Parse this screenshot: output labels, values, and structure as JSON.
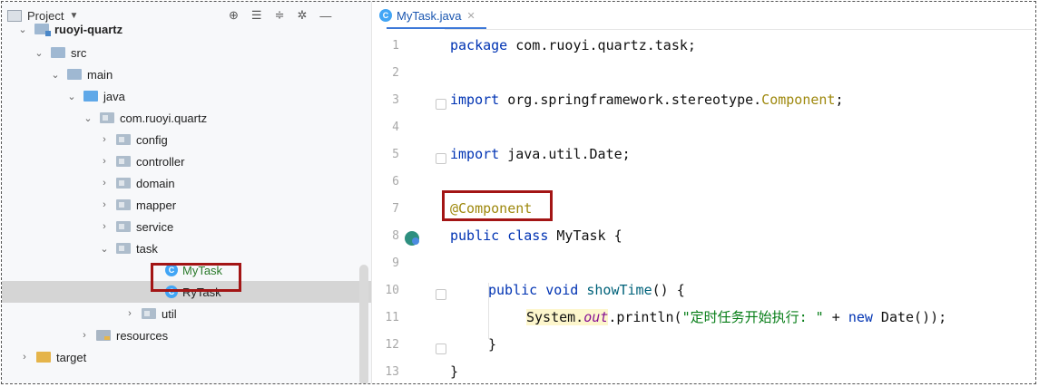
{
  "project_panel": {
    "title": "Project",
    "tree": [
      {
        "label": "ruoyi-quartz"
      },
      {
        "label": "src"
      },
      {
        "label": "main"
      },
      {
        "label": "java"
      },
      {
        "label": "com.ruoyi.quartz"
      },
      {
        "label": "config"
      },
      {
        "label": "controller"
      },
      {
        "label": "domain"
      },
      {
        "label": "mapper"
      },
      {
        "label": "service"
      },
      {
        "label": "task"
      },
      {
        "label": "MyTask"
      },
      {
        "label": "RyTask"
      },
      {
        "label": "util"
      },
      {
        "label": "resources"
      },
      {
        "label": "target"
      }
    ]
  },
  "editor": {
    "tab_label": "MyTask.java",
    "line_numbers": [
      "1",
      "2",
      "3",
      "4",
      "5",
      "6",
      "7",
      "8",
      "9",
      "10",
      "11",
      "12",
      "13"
    ],
    "code": {
      "l1_kw": "package",
      "l1_rest": " com.ruoyi.quartz.task;",
      "l3_kw": "import",
      "l3_rest": " org.springframework.stereotype.",
      "l3_type": "Component",
      "l3_end": ";",
      "l5_kw": "import",
      "l5_rest": " java.util.Date;",
      "l7_ann": "@Component",
      "l8_kw": "public class",
      "l8_rest": " MyTask {",
      "l10_kw": "public void",
      "l10_fn": " showTime",
      "l10_rest": "() {",
      "l11_sys": "System.",
      "l11_out": "out",
      "l11_mid": ".println(",
      "l11_str": "\"定时任务开始执行: \"",
      "l11_plus": " + ",
      "l11_new": "new",
      "l11_end": " Date());",
      "l12": "}",
      "l13": "}"
    }
  },
  "colors": {
    "highlight_box": "#a31515",
    "keyword": "#0033b3",
    "annotation": "#9e880d",
    "string": "#067d17"
  }
}
